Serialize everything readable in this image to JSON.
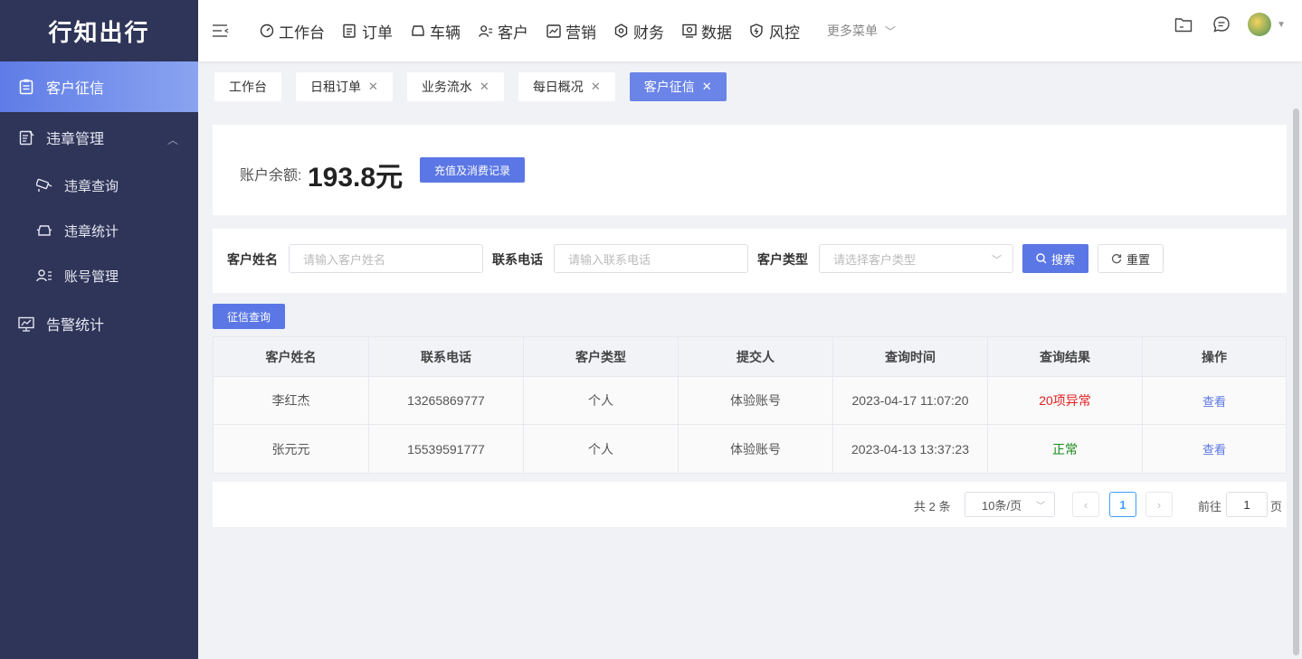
{
  "app": {
    "title": "行知出行"
  },
  "sidebar": {
    "items": [
      {
        "label": "客户征信",
        "icon": "clipboard-icon",
        "active": true
      },
      {
        "label": "违章管理",
        "icon": "document-edit-icon",
        "expanded": true,
        "children": [
          {
            "label": "违章查询",
            "icon": "camera-icon"
          },
          {
            "label": "违章统计",
            "icon": "car-icon"
          },
          {
            "label": "账号管理",
            "icon": "user-list-icon"
          }
        ]
      },
      {
        "label": "告警统计",
        "icon": "monitor-chart-icon"
      }
    ]
  },
  "topnav": {
    "items": [
      {
        "label": "工作台",
        "icon": "dashboard-icon"
      },
      {
        "label": "订单",
        "icon": "order-icon"
      },
      {
        "label": "车辆",
        "icon": "car-icon"
      },
      {
        "label": "客户",
        "icon": "users-icon"
      },
      {
        "label": "营销",
        "icon": "trend-icon"
      },
      {
        "label": "财务",
        "icon": "finance-icon"
      },
      {
        "label": "数据",
        "icon": "data-icon"
      },
      {
        "label": "风控",
        "icon": "shield-icon"
      }
    ],
    "more": "更多菜单"
  },
  "tabs": [
    {
      "label": "工作台",
      "closable": false
    },
    {
      "label": "日租订单",
      "closable": true
    },
    {
      "label": "业务流水",
      "closable": true
    },
    {
      "label": "每日概况",
      "closable": true
    },
    {
      "label": "客户征信",
      "closable": true,
      "active": true
    }
  ],
  "balance": {
    "label": "账户余额:",
    "value": "193.8元",
    "record_button": "充值及消费记录"
  },
  "filters": {
    "name_label": "客户姓名",
    "name_placeholder": "请输入客户姓名",
    "phone_label": "联系电话",
    "phone_placeholder": "请输入联系电话",
    "type_label": "客户类型",
    "type_placeholder": "请选择客户类型",
    "search_button": "搜索",
    "reset_button": "重置"
  },
  "credit_query_button": "征信查询",
  "table": {
    "headers": [
      "客户姓名",
      "联系电话",
      "客户类型",
      "提交人",
      "查询时间",
      "查询结果",
      "操作"
    ],
    "rows": [
      {
        "name": "李红杰",
        "phone": "13265869777",
        "type": "个人",
        "submitter": "体验账号",
        "time": "2023-04-17 11:07:20",
        "result": "20项异常",
        "result_color": "#e02020",
        "action": "查看"
      },
      {
        "name": "张元元",
        "phone": "15539591777",
        "type": "个人",
        "submitter": "体验账号",
        "time": "2023-04-13 13:37:23",
        "result": "正常",
        "result_color": "#1a8a1a",
        "action": "查看"
      }
    ]
  },
  "pagination": {
    "total": "共 2 条",
    "page_size": "10条/页",
    "current_page": "1",
    "goto_label": "前往",
    "goto_value": "1",
    "page_suffix": "页"
  },
  "colors": {
    "sidebar_bg": "#2f3558",
    "accent": "#5b77e5",
    "active_tab": "#6b84e8"
  }
}
